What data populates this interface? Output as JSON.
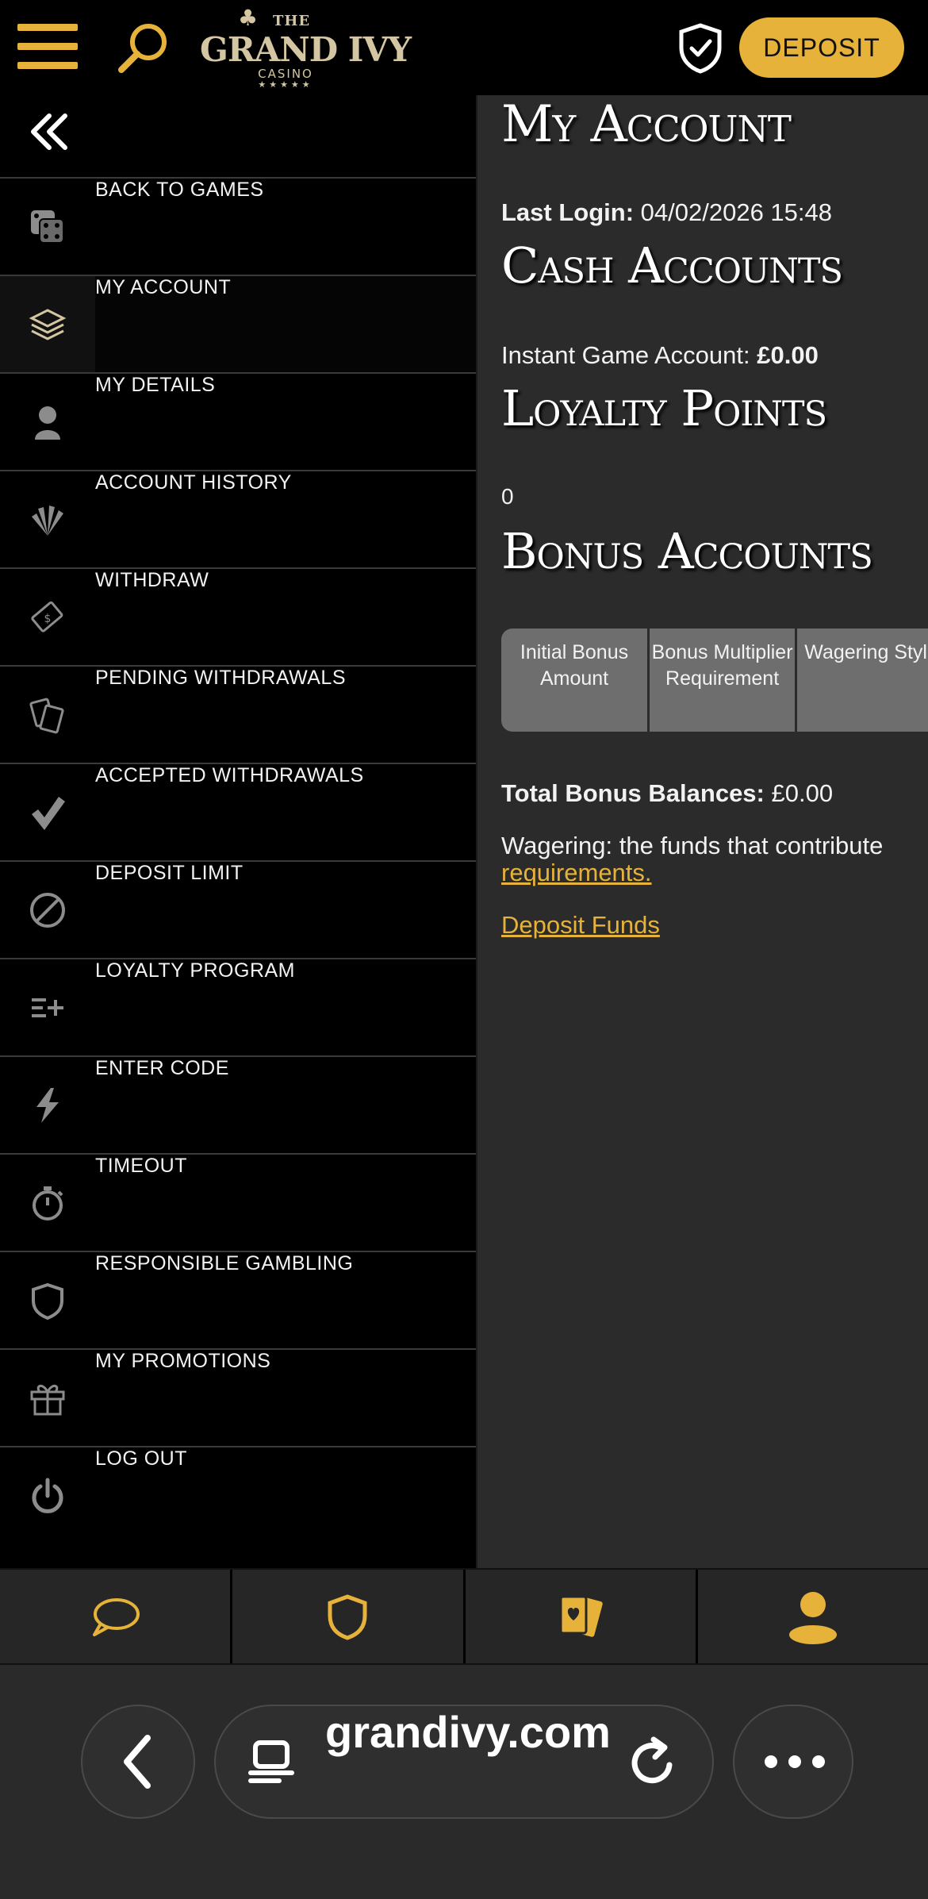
{
  "header": {
    "logo": {
      "the": "THE",
      "name": "GRAND IVY",
      "casino": "CASINO",
      "stars": "★★★★★"
    },
    "deposit_label": "DEPOSIT"
  },
  "sidebar": {
    "items": [
      {
        "label": "BACK TO GAMES",
        "icon": "dice-icon"
      },
      {
        "label": "MY ACCOUNT",
        "icon": "layers-icon",
        "active": true
      },
      {
        "label": "MY DETAILS",
        "icon": "person-icon"
      },
      {
        "label": "ACCOUNT HISTORY",
        "icon": "fan-icon"
      },
      {
        "label": "WITHDRAW",
        "icon": "money-icon"
      },
      {
        "label": "PENDING WITHDRAWALS",
        "icon": "cards-icon"
      },
      {
        "label": "ACCEPTED WITHDRAWALS",
        "icon": "checkmark-icon"
      },
      {
        "label": "DEPOSIT LIMIT",
        "icon": "prohibit-icon"
      },
      {
        "label": "LOYALTY PROGRAM",
        "icon": "list-plus-icon"
      },
      {
        "label": "ENTER CODE",
        "icon": "lightning-icon"
      },
      {
        "label": "TIMEOUT",
        "icon": "stopwatch-icon"
      },
      {
        "label": "RESPONSIBLE GAMBLING",
        "icon": "shield-icon"
      },
      {
        "label": "MY PROMOTIONS",
        "icon": "gift-icon"
      },
      {
        "label": "LOG OUT",
        "icon": "power-icon"
      }
    ]
  },
  "main": {
    "title": "My Account",
    "last_login_label": "Last Login:",
    "last_login_value": "04/02/2026 15:48",
    "cash_heading": "Cash Accounts",
    "instant_label": "Instant Game Account:",
    "instant_value": "£0.00",
    "loyalty_heading": "Loyalty Points",
    "loyalty_value": "0",
    "bonus_heading": "Bonus Accounts",
    "bonus_table_headers": [
      "Initial Bonus Amount",
      "Bonus Multiplier Requirement",
      "Wagering Style"
    ],
    "total_label": "Total Bonus Balances:",
    "total_value": "£0.00",
    "wagering_text": "Wagering: the funds that contribute",
    "requirements_link": "requirements.",
    "deposit_funds_link": "Deposit Funds"
  },
  "tabbar": {
    "items": [
      "chat-icon",
      "shield-icon",
      "cards-heart-icon",
      "user-icon"
    ]
  },
  "browser": {
    "url": "grandivy.com"
  },
  "colors": {
    "accent": "#e7b23a",
    "sidebar_bg": "#000000",
    "content_bg": "#2b2b2b"
  }
}
